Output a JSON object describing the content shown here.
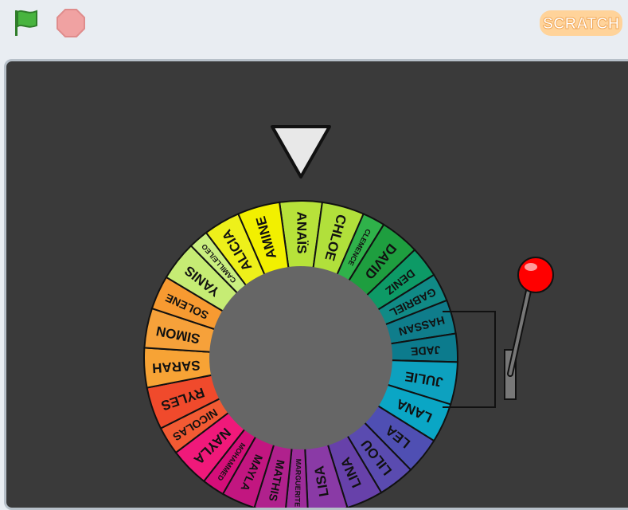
{
  "toolbar": {
    "green_flag_icon": "green-flag-icon",
    "stop_icon": "stop-icon",
    "logo_text": "SCRATCH"
  },
  "wheel": {
    "segments": [
      {
        "name": "ANAÏS",
        "color": "#b7e23a",
        "size": 15
      },
      {
        "name": "CHLOE",
        "color": "#b1e03b",
        "size": 15
      },
      {
        "name": "CLEMENCE",
        "color": "#2fb24a",
        "size": 8
      },
      {
        "name": "DAVID",
        "color": "#1e9e3f",
        "size": 14
      },
      {
        "name": "DENIZ",
        "color": "#0d9a66",
        "size": 11
      },
      {
        "name": "GABRIEL",
        "color": "#108a86",
        "size": 10
      },
      {
        "name": "HASSAN",
        "color": "#0f7d8b",
        "size": 12
      },
      {
        "name": "JADE",
        "color": "#0c7b8d",
        "size": 10
      },
      {
        "name": "JULIE",
        "color": "#0da1bf",
        "size": 15
      },
      {
        "name": "LANA",
        "color": "#0aa6c5",
        "size": 14
      },
      {
        "name": "LEA",
        "color": "#4f4fb3",
        "size": 13
      },
      {
        "name": "LILOU",
        "color": "#5a4bb0",
        "size": 13
      },
      {
        "name": "LINA",
        "color": "#6741aa",
        "size": 13
      },
      {
        "name": "LISA",
        "color": "#8a3aa6",
        "size": 14
      },
      {
        "name": "MARGUERITE",
        "color": "#9d2c9a",
        "size": 8
      },
      {
        "name": "MATHIS",
        "color": "#b0218d",
        "size": 11
      },
      {
        "name": "MAYLA",
        "color": "#c21680",
        "size": 12
      },
      {
        "name": "MOHAMMED",
        "color": "#d50e79",
        "size": 8
      },
      {
        "name": "NAYLA",
        "color": "#f0197a",
        "size": 14
      },
      {
        "name": "NICOLAS",
        "color": "#f25a33",
        "size": 10
      },
      {
        "name": "RYLES",
        "color": "#f04a2c",
        "size": 15
      },
      {
        "name": "SARAH",
        "color": "#f7a335",
        "size": 14
      },
      {
        "name": "SIMON",
        "color": "#f6a13a",
        "size": 14
      },
      {
        "name": "SOLENE",
        "color": "#f79a31",
        "size": 12
      },
      {
        "name": "YANIS",
        "color": "#c6ec74",
        "size": 14
      },
      {
        "name": "CAMILLE/LEO",
        "color": "#caef80",
        "size": 7
      },
      {
        "name": "ALICIA",
        "color": "#eef01a",
        "size": 13
      },
      {
        "name": "AMINE",
        "color": "#f2f000",
        "size": 15
      }
    ]
  },
  "lever": {
    "knob_color": "#ff0000"
  },
  "pointer": {
    "color": "#e8e8e8"
  }
}
